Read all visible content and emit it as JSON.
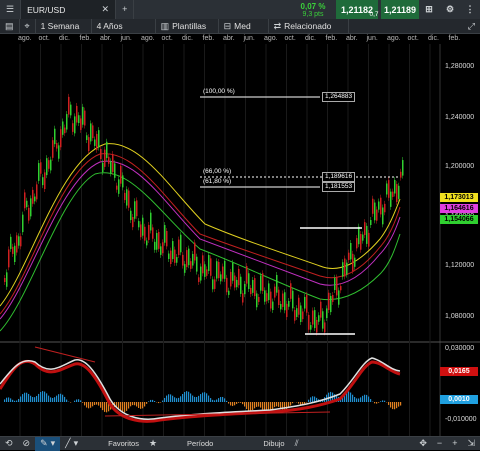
{
  "window": {
    "symbol": "EUR/USD",
    "close_icon": "close-icon",
    "add_icon": "plus-icon"
  },
  "quote": {
    "change_pct": "0,07 %",
    "change_pips": "9,3 pts",
    "bid": "1,21182",
    "ask": "1,21189",
    "spread": "0,7",
    "buy_icon": "buy-icon"
  },
  "toolbar": {
    "period": "1 Semana",
    "range": "4 Años",
    "templates": "Plantillas",
    "med": "Med",
    "related": "Relacionado"
  },
  "months": [
    "ago.",
    "oct.",
    "dic.",
    "feb.",
    "abr.",
    "jun.",
    "ago.",
    "oct.",
    "dic.",
    "feb.",
    "abr.",
    "jun.",
    "ago.",
    "oct.",
    "dic.",
    "feb.",
    "abr.",
    "jun.",
    "ago.",
    "oct.",
    "dic.",
    "feb."
  ],
  "price_axis": [
    "1,280000",
    "1,240000",
    "1,200000",
    "1,160000",
    "1,120000",
    "1,080000"
  ],
  "osc_axis": [
    "0,030000",
    "-0,010000"
  ],
  "fib": {
    "l100": "(100,00 %)",
    "v100": "1,264883",
    "l66": "(66,00 %)",
    "v66": "1,189616",
    "l618": "(61,80 %)",
    "v618": "1,181553"
  },
  "tags": {
    "yellow": "1,173013",
    "magenta": "1,164616",
    "green": "1,154066",
    "red": "0,0165",
    "blue": "0,0010"
  },
  "colors": {
    "yellow": "#f0e020",
    "magenta": "#e040e0",
    "green": "#30d030",
    "red": "#d01010",
    "blue": "#20a0e0"
  },
  "bottom": {
    "favorites": "Favoritos",
    "period": "Período",
    "drawing": "Dibujo"
  }
}
